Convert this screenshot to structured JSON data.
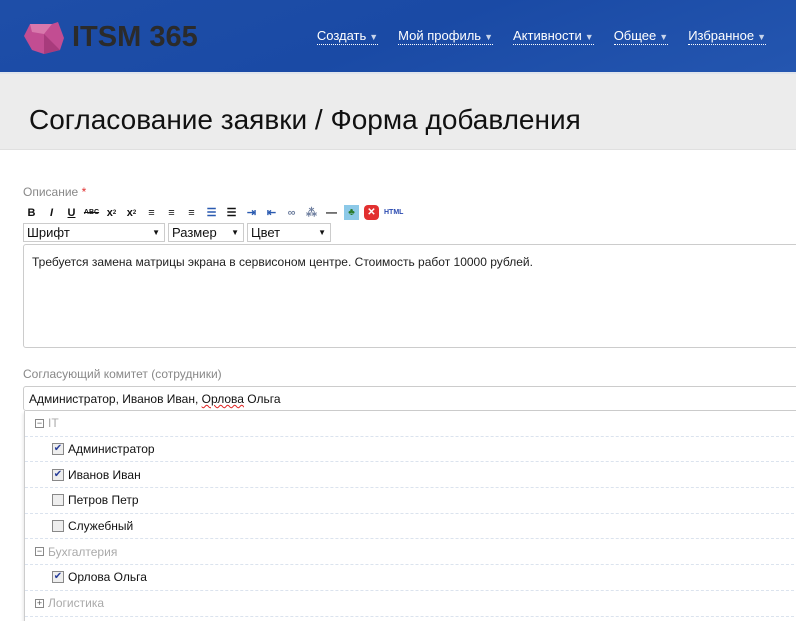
{
  "header": {
    "logo_text": "ITSM 365",
    "nav": [
      "Создать",
      "Мой профиль",
      "Активности",
      "Общее",
      "Избранное"
    ]
  },
  "page_title": "Согласование заявки / Форма добавления",
  "description": {
    "label": "Описание",
    "required_mark": "*",
    "toolbar_html": "HTML",
    "font_select": "Шрифт",
    "size_select": "Размер",
    "color_select": "Цвет",
    "text": "Требуется замена матрицы экрана в сервисоном центре. Стоимость работ 10000 рублей."
  },
  "committee": {
    "label": "Согласующий комитет (сотрудники)",
    "value_part1": "Администратор, Иванов Иван, ",
    "value_part2": "Орлова",
    "value_part3": " Ольга",
    "groups": [
      {
        "name": "IT",
        "expanded": true,
        "items": [
          {
            "name": "Администратор",
            "checked": true
          },
          {
            "name": "Иванов Иван",
            "checked": true
          },
          {
            "name": "Петров Петр",
            "checked": false
          },
          {
            "name": "Служебный",
            "checked": false
          }
        ]
      },
      {
        "name": "Бухгалтерия",
        "expanded": true,
        "items": [
          {
            "name": "Орлова Ольга",
            "checked": true
          }
        ]
      },
      {
        "name": "Логистика",
        "expanded": false,
        "items": []
      }
    ]
  },
  "colors": {
    "header": "#1e4ea8",
    "logo": "#c04a90"
  }
}
